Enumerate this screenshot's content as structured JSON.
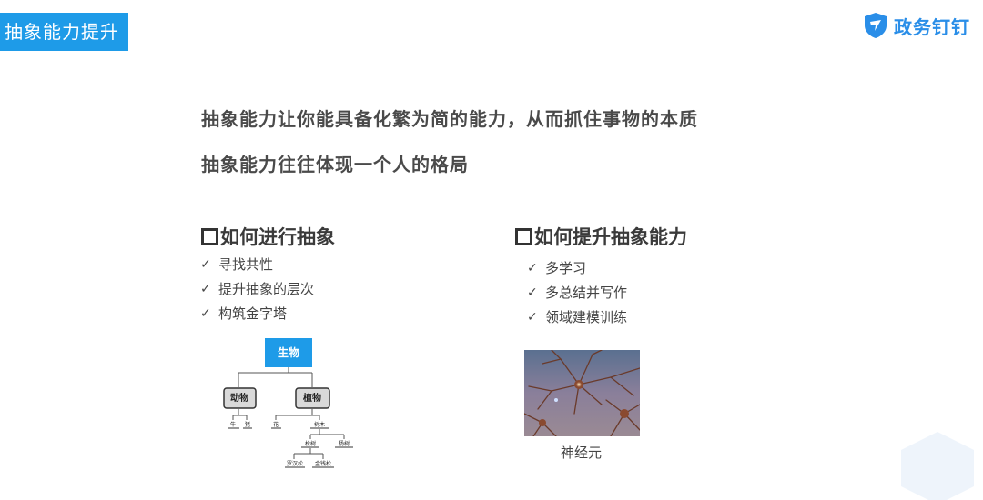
{
  "header": {
    "title": "抽象能力提升",
    "brand": "政务钉钉"
  },
  "statements": [
    "抽象能力让你能具备化繁为简的能力，从而抓住事物的本质",
    "抽象能力往往体现一个人的格局"
  ],
  "left_section": {
    "heading": "如何进行抽象",
    "items": [
      "寻找共性",
      "提升抽象的层次",
      "构筑金字塔"
    ]
  },
  "right_section": {
    "heading": "如何提升抽象能力",
    "items": [
      "多学习",
      "多总结并写作",
      "领域建模训练"
    ]
  },
  "tree": {
    "root": "生物",
    "level1": [
      "动物",
      "植物"
    ],
    "animal_children": [
      "牛",
      "猪"
    ],
    "plant_children": [
      "花",
      "树木"
    ],
    "tree_children": [
      "松树",
      "杨树"
    ],
    "pine_children": [
      "罗汉松",
      "金钱松"
    ]
  },
  "image_caption": "神经元",
  "colors": {
    "accent": "#1e9be8",
    "brand": "#2a8ee8"
  },
  "icons": {
    "check": "check-icon",
    "bullet": "square-bullet-icon",
    "logo": "shield-logo-icon"
  }
}
